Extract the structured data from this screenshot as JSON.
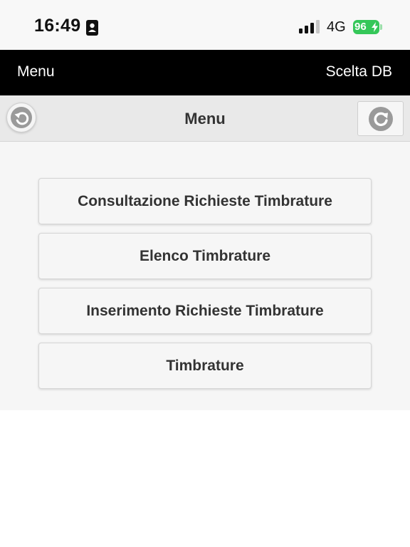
{
  "status_bar": {
    "time": "16:49",
    "network": "4G",
    "battery_level": "96",
    "battery_color": "#35c759",
    "icons": [
      "id-badge-icon",
      "signal-bars-icon",
      "battery-charging-icon"
    ]
  },
  "navbar": {
    "left_link": "Menu",
    "right_link": "Scelta DB",
    "background": "#000000"
  },
  "header": {
    "title": "Menu",
    "back_icon": "undo-arrow-icon",
    "refresh_icon": "refresh-icon"
  },
  "menu": {
    "items": [
      {
        "label": "Consultazione Richieste Timbrature"
      },
      {
        "label": "Elenco Timbrature"
      },
      {
        "label": "Inserimento Richieste Timbrature"
      },
      {
        "label": "Timbrature"
      }
    ]
  }
}
